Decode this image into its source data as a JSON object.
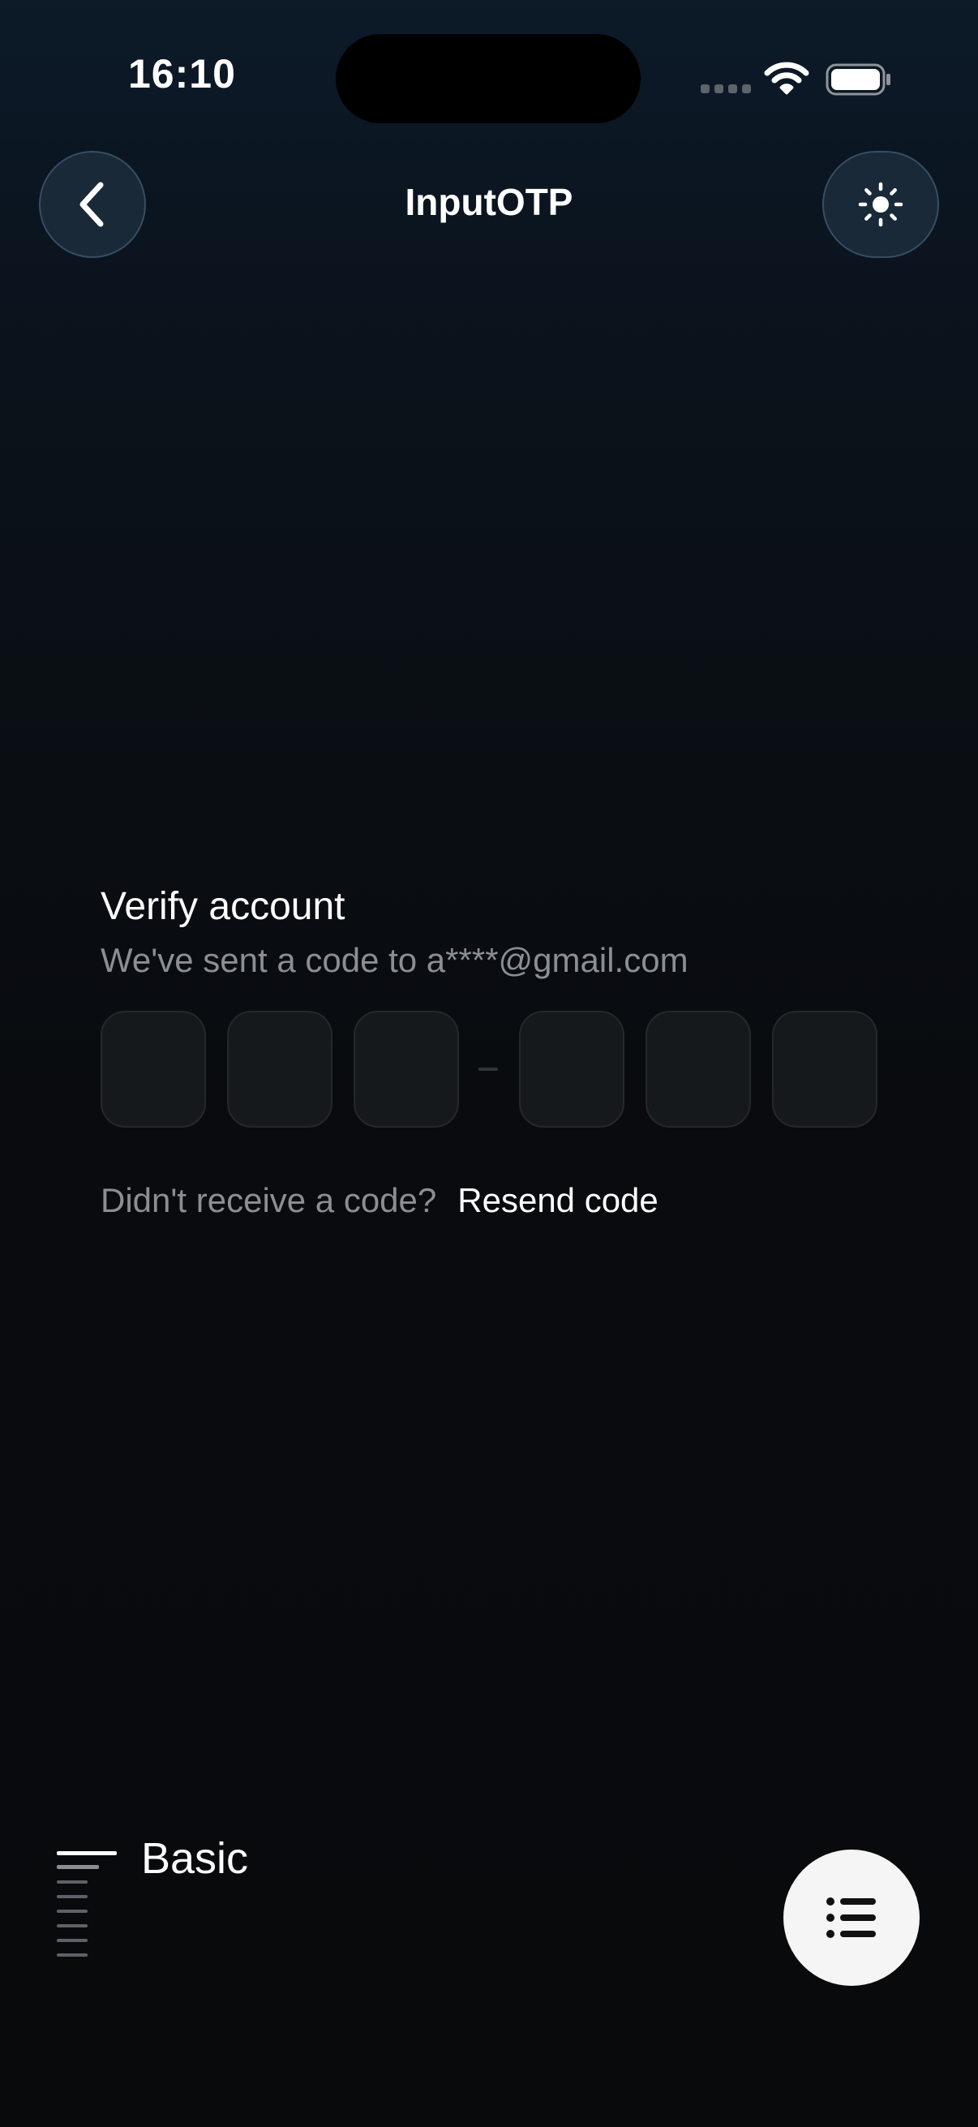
{
  "status_bar": {
    "time": "16:10",
    "icons": [
      "signal-dots-icon",
      "wifi-icon",
      "battery-icon"
    ]
  },
  "header": {
    "title": "InputOTP",
    "back_icon": "chevron-left-icon",
    "theme_icon": "sun-icon"
  },
  "card": {
    "title": "Verify account",
    "subtitle": "We've sent a code to a****@gmail.com",
    "otp": {
      "group_one": [
        "",
        "",
        ""
      ],
      "separator": "-",
      "group_two": [
        "",
        "",
        ""
      ]
    },
    "resend_prompt": "Didn't receive a code?",
    "resend_link": "Resend code"
  },
  "section": {
    "label": "Basic"
  },
  "fab": {
    "icon": "list-icon"
  },
  "colors": {
    "background_top": "#0c1a29",
    "background_bottom": "#090a0c",
    "muted_text": "#8b8f94",
    "slot_fill": "#16191c",
    "fab_fill": "#f5f5f5"
  }
}
